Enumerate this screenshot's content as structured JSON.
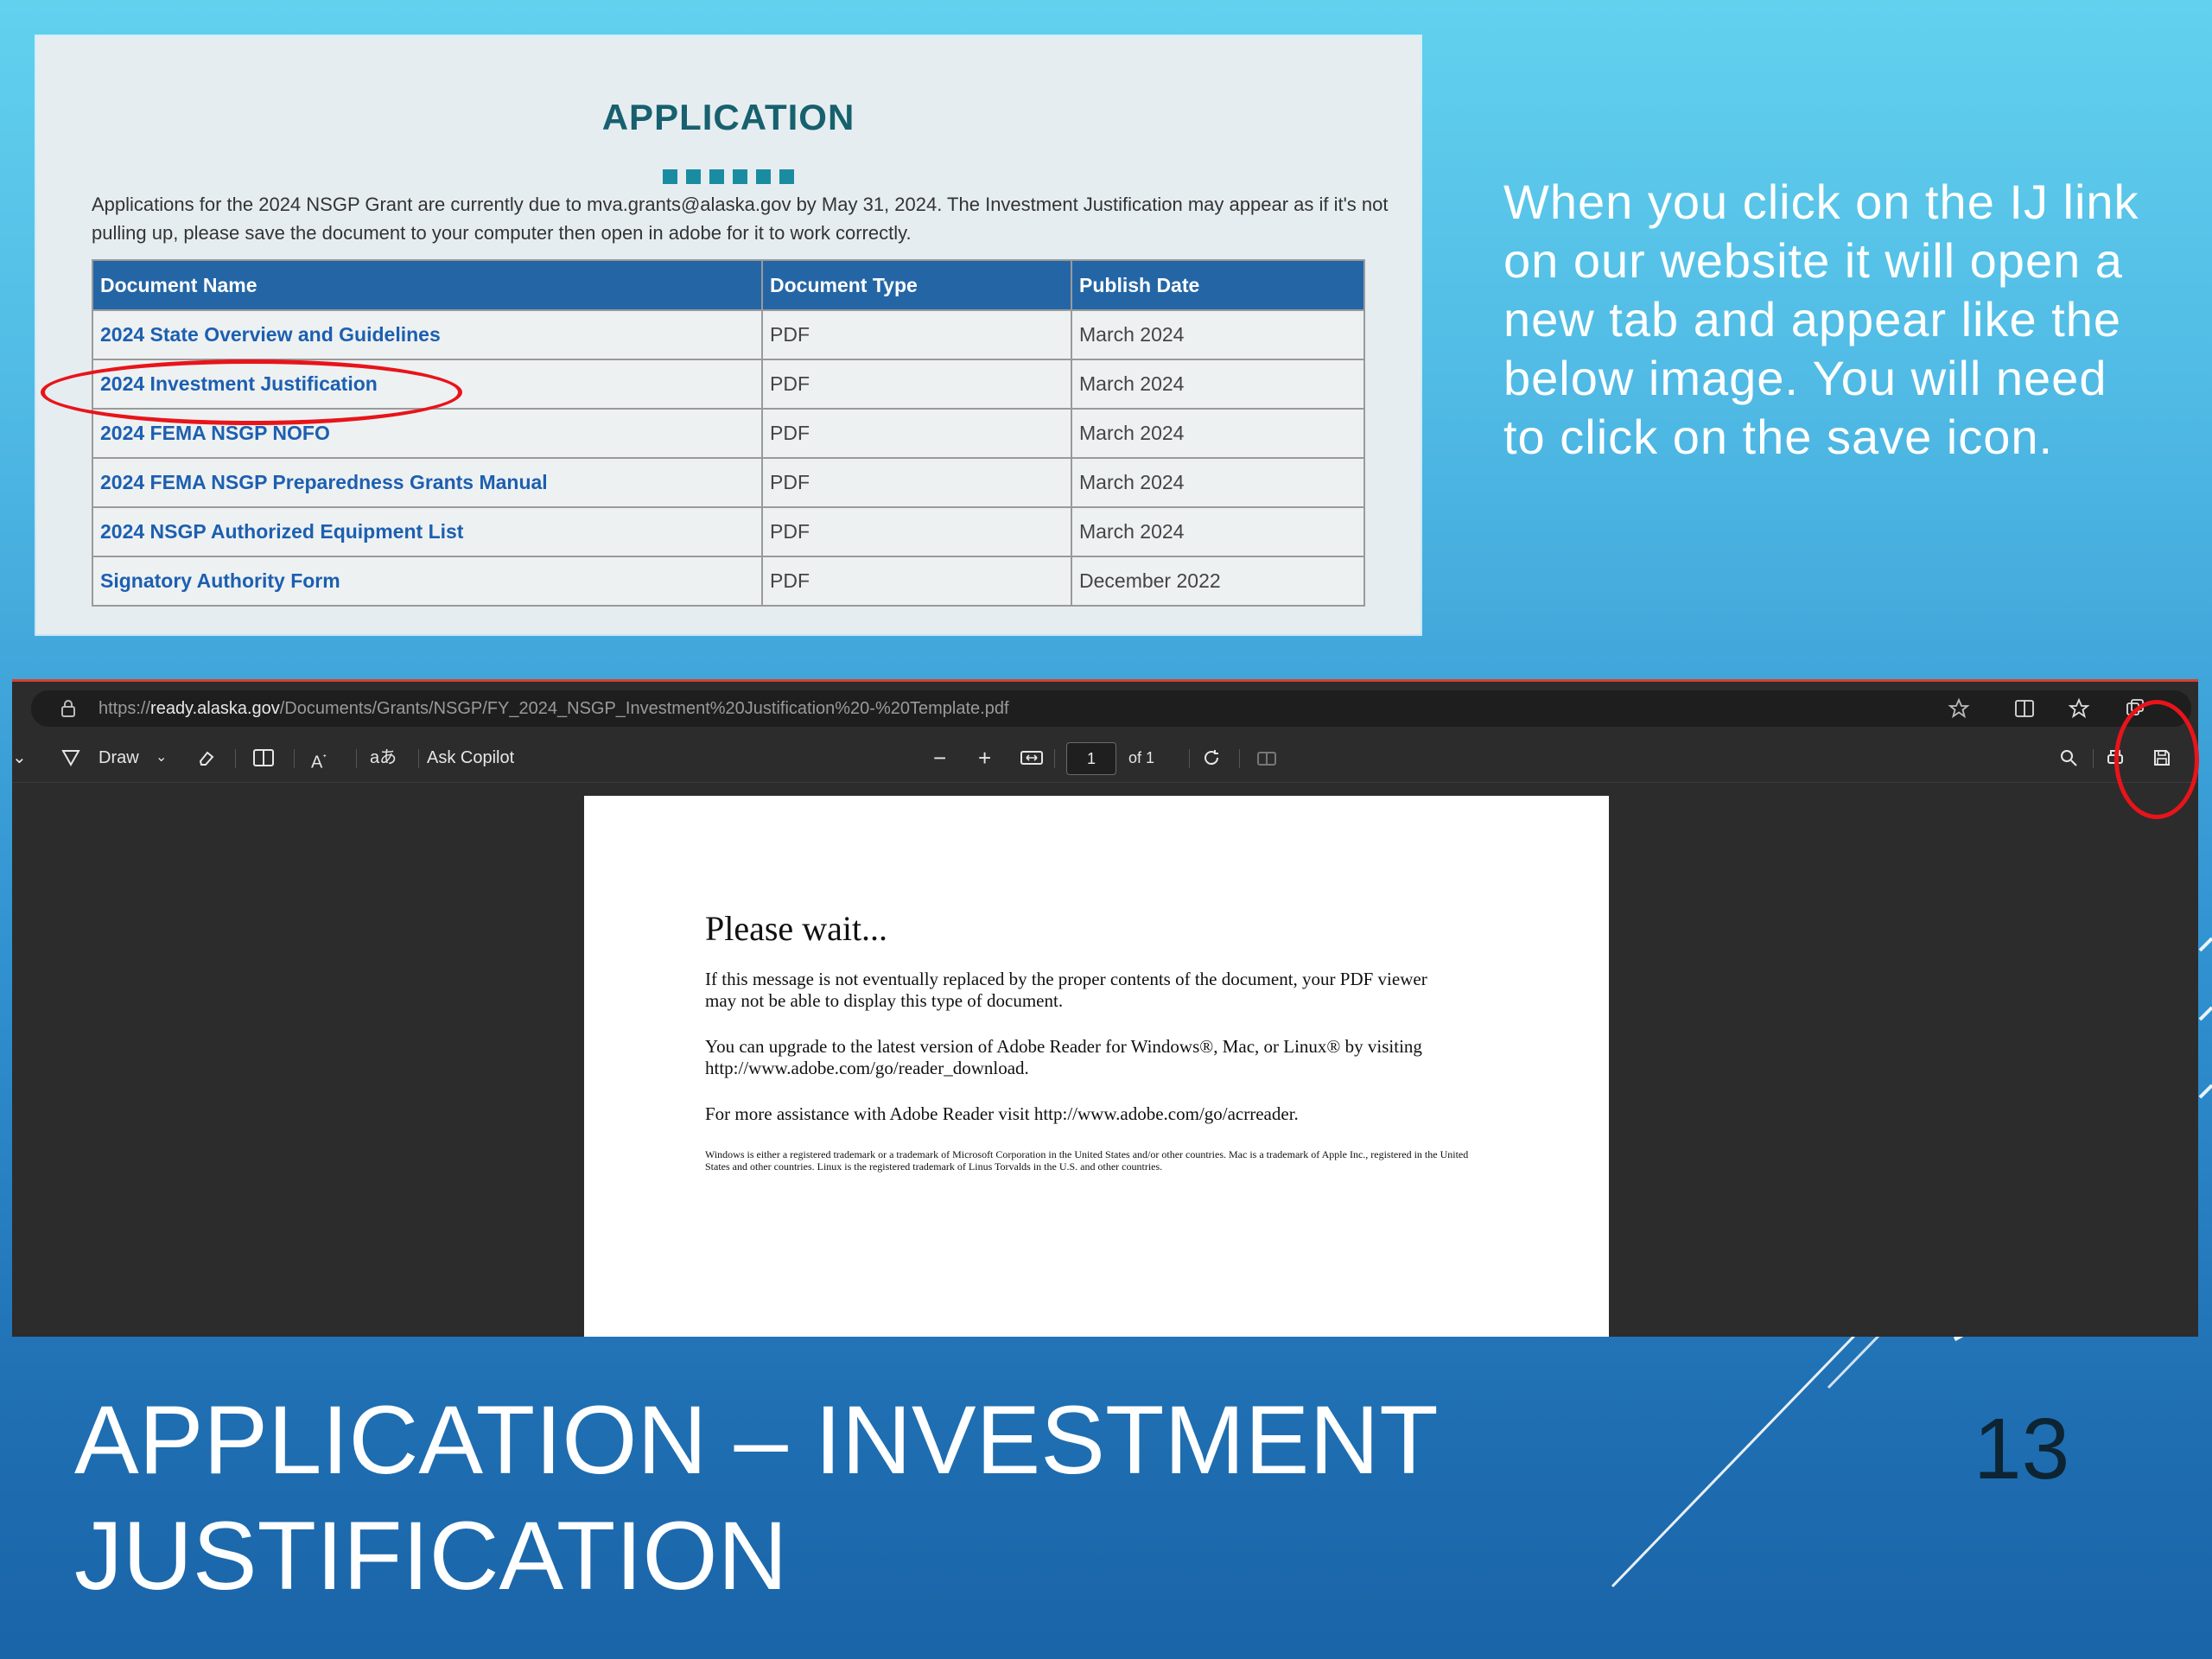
{
  "application": {
    "title": "APPLICATION",
    "intro": "Applications for the 2024 NSGP Grant are currently due to mva.grants@alaska.gov by May 31, 2024.  The Investment Justification may appear as if it's not pulling up, please save the document to your computer then open in adobe for it to work correctly.",
    "headers": [
      "Document Name",
      "Document Type",
      "Publish Date"
    ],
    "rows": [
      {
        "name": "2024 State Overview and Guidelines",
        "type": "PDF",
        "date": "March 2024"
      },
      {
        "name": "2024 Investment Justification",
        "type": "PDF",
        "date": "March 2024"
      },
      {
        "name": "2024 FEMA NSGP NOFO",
        "type": "PDF",
        "date": "March 2024"
      },
      {
        "name": "2024 FEMA NSGP Preparedness Grants Manual",
        "type": "PDF",
        "date": "March 2024"
      },
      {
        "name": "2024 NSGP Authorized Equipment List",
        "type": "PDF",
        "date": "March 2024"
      },
      {
        "name": "Signatory Authority Form",
        "type": "PDF",
        "date": "December 2022"
      }
    ]
  },
  "instructions": "When you click on the IJ link on our website it will open a new tab and appear like the below image.  You will need to click on the save icon.",
  "browser": {
    "url_prefix": "https://",
    "url_domain": "ready.alaska.gov",
    "url_path": "/Documents/Grants/NSGP/FY_2024_NSGP_Investment%20Justification%20-%20Template.pdf",
    "toolbar": {
      "draw": "Draw",
      "ask_copilot": "Ask Copilot",
      "page_number": "1",
      "page_total": "of 1"
    }
  },
  "pdf": {
    "title": "Please wait...",
    "p1": "If this message is not eventually replaced by the proper contents of the document, your PDF viewer may not be able to display this type of document.",
    "p2": "You can upgrade to the latest version of Adobe Reader for Windows®, Mac, or Linux® by visiting  http://www.adobe.com/go/reader_download.",
    "p3": "For more assistance with Adobe Reader visit  http://www.adobe.com/go/acrreader.",
    "footnote": "Windows is either a registered trademark or a trademark of Microsoft Corporation in the United States and/or other countries. Mac is a trademark of Apple Inc., registered in the United States and other countries. Linux is the registered trademark of Linus Torvalds in the U.S. and other countries."
  },
  "slide": {
    "title_line1": "APPLICATION – INVESTMENT",
    "title_line2": "JUSTIFICATION",
    "number": "13"
  },
  "colors": {
    "highlight_circle": "#e8141a",
    "table_header": "#2466a5",
    "link": "#1c5fb0",
    "app_title": "#17616f"
  }
}
